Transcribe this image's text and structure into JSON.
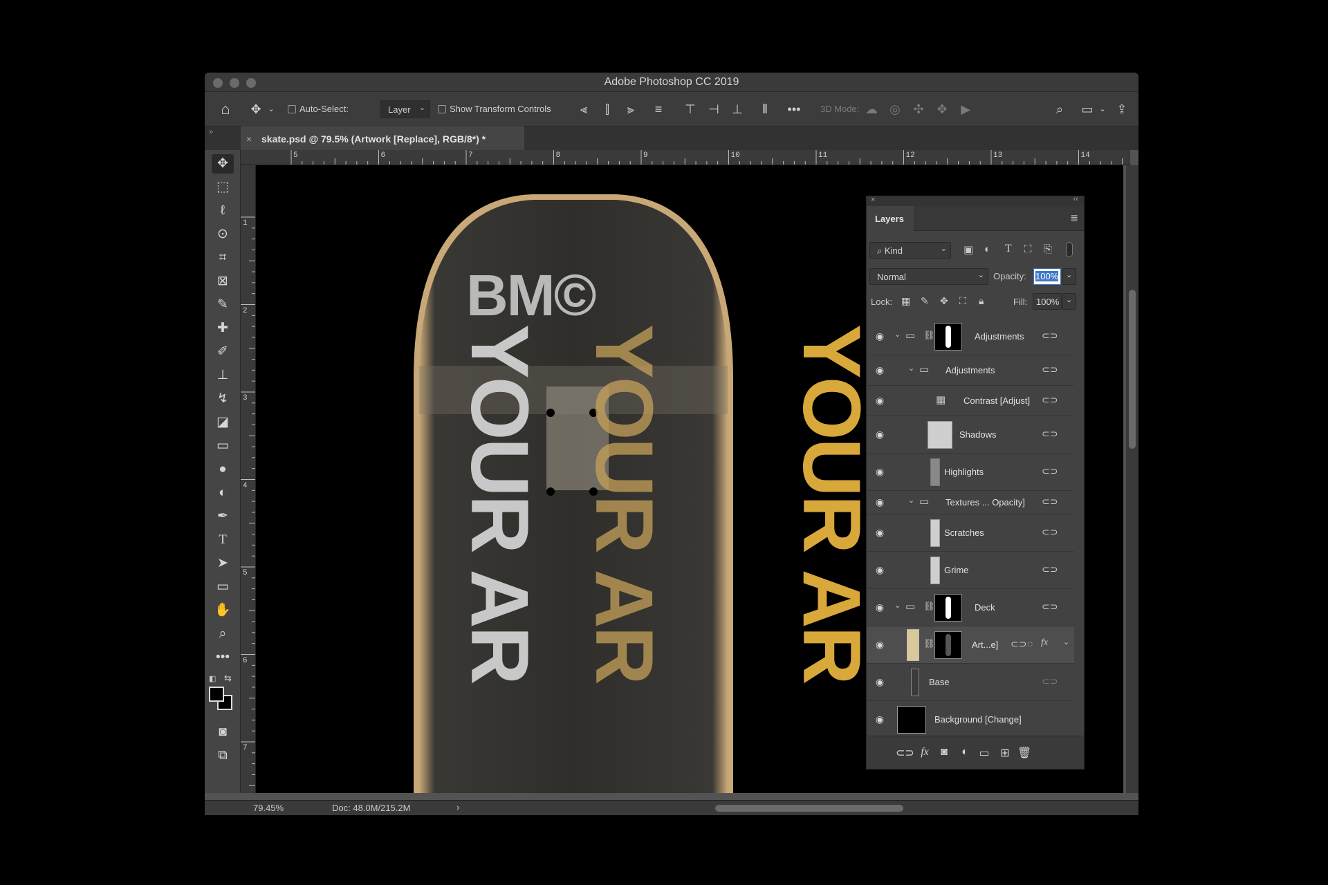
{
  "window": {
    "title": "Adobe Photoshop CC 2019"
  },
  "options_bar": {
    "auto_select_label": "Auto-Select:",
    "auto_select_value": "Layer",
    "transform_controls_label": "Show Transform Controls",
    "three_d_mode_label": "3D Mode:"
  },
  "document_tab": {
    "label": "skate.psd @ 79.5% (Artwork [Replace], RGB/8*) *",
    "close": "×"
  },
  "rulers": {
    "top": [
      "5",
      "6",
      "7",
      "8",
      "9",
      "10",
      "11",
      "12",
      "13",
      "14"
    ],
    "left": [
      "1",
      "2",
      "3",
      "4",
      "5",
      "6",
      "7"
    ]
  },
  "artwork": {
    "logo": "BM©",
    "yellow_text": "YOUR AR",
    "white_text": "YOUR AR"
  },
  "layers_panel": {
    "tab_label": "Layers",
    "filter_kind": "Kind",
    "blend_mode": "Normal",
    "opacity_label": "Opacity:",
    "opacity_value": "100%",
    "lock_label": "Lock:",
    "fill_label": "Fill:",
    "fill_value": "100%",
    "layers": [
      {
        "name": "Adjustments"
      },
      {
        "name": "Adjustments"
      },
      {
        "name": "Contrast [Adjust]"
      },
      {
        "name": "Shadows"
      },
      {
        "name": "Highlights"
      },
      {
        "name": "Textures ... Opacity]"
      },
      {
        "name": "Scratches"
      },
      {
        "name": "Grime"
      },
      {
        "name": "Deck"
      },
      {
        "name": "Art...e]"
      },
      {
        "name": "Base"
      },
      {
        "name": "Background [Change]"
      }
    ]
  },
  "status_bar": {
    "zoom": "79.45%",
    "doc_info": "Doc: 48.0M/215.2M",
    "arrow": "›"
  },
  "colors": {
    "accent_yellow": "#d9a83a",
    "deck_dark": "#2e2d2a",
    "ui_panel": "#424242"
  }
}
